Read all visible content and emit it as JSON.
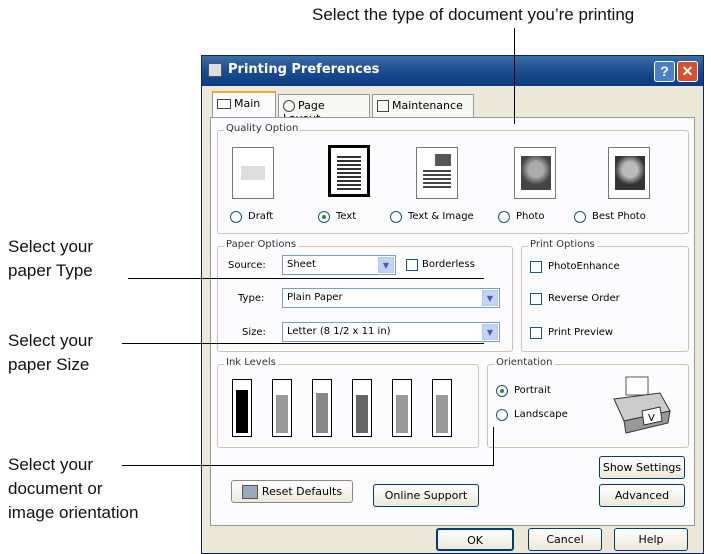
{
  "callouts": {
    "top": "Select the type of document you’re printing",
    "type_1": "Select your",
    "type_2": "paper Type",
    "size_1": "Select your",
    "size_2": "paper Size",
    "orient_1": "Select your",
    "orient_2": "document or",
    "orient_3": "image orientation"
  },
  "window": {
    "title": "Printing Preferences",
    "help_btn": "?",
    "close_btn": "✕"
  },
  "tabs": [
    "Main",
    "Page Layout",
    "Maintenance"
  ],
  "quality": {
    "group_label": "Quality Option",
    "options": [
      "Draft",
      "Text",
      "Text & Image",
      "Photo",
      "Best Photo"
    ],
    "selected": "Text"
  },
  "paper": {
    "group_label": "Paper Options",
    "source_label": "Source:",
    "source_value": "Sheet",
    "borderless_label": "Borderless",
    "type_label": "Type:",
    "type_value": "Plain Paper",
    "size_label": "Size:",
    "size_value": "Letter (8 1/2 x 11 in)"
  },
  "print_options": {
    "group_label": "Print Options",
    "items": [
      "PhotoEnhance",
      "Reverse Order",
      "Print Preview"
    ]
  },
  "ink": {
    "group_label": "Ink Levels",
    "levels": [
      0.85,
      0.75,
      0.8,
      0.75,
      0.75,
      0.75
    ],
    "colors": [
      "#000000",
      "#999999",
      "#888888",
      "#666666",
      "#999999",
      "#999999"
    ]
  },
  "orientation": {
    "group_label": "Orientation",
    "portrait": "Portrait",
    "landscape": "Landscape",
    "selected": "Portrait"
  },
  "buttons": {
    "show_settings": "Show Settings",
    "reset_defaults": "Reset Defaults",
    "online_support": "Online Support",
    "advanced": "Advanced",
    "ok": "OK",
    "cancel": "Cancel",
    "help": "Help"
  }
}
